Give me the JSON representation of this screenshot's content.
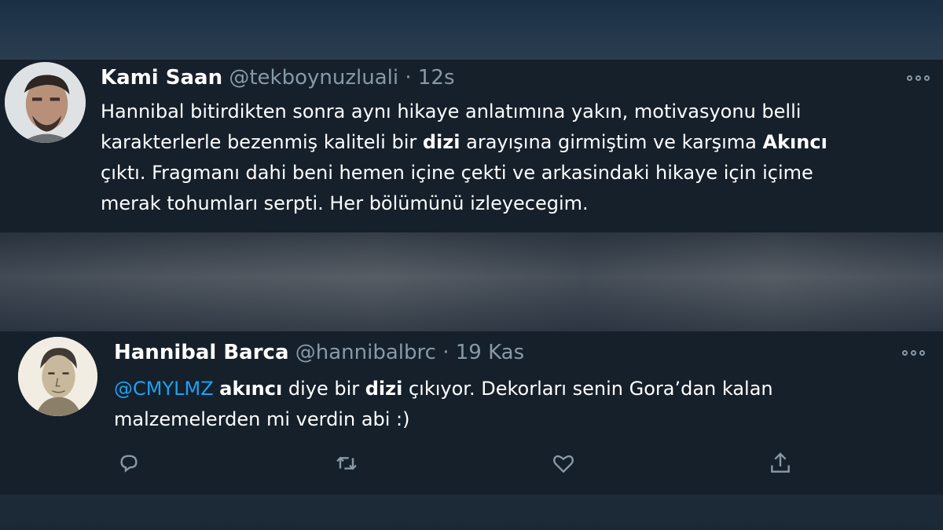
{
  "tweet1": {
    "name": "Kami Saan",
    "handle": "@tekboynuzluali",
    "separator": "·",
    "time": "12s",
    "body": {
      "line1": "Hannibal bitirdikten sonra aynı hikaye anlatımına yakın, motivasyonu belli",
      "line2_pre": "karakterlerle bezenmiş kaliteli bir ",
      "line2_bold1": "dizi",
      "line2_mid": " arayışına girmiştim ve karşıma ",
      "line2_bold2": "Akıncı",
      "line3": "çıktı. Fragmanı dahi beni hemen içine çekti ve arkasindaki hikaye için içime",
      "line4": "merak tohumları serpti. Her bölümünü izleyecegim."
    }
  },
  "tweet2": {
    "name": "Hannibal Barca",
    "handle": "@hannibalbrc",
    "separator": "·",
    "time": "19 Kas",
    "body": {
      "mention": "@CMYLMZ",
      "bold1": "akıncı",
      "mid1": " diye bir ",
      "bold2": "dizi",
      "rest_line1": " çıkıyor. Dekorları senin Gora’dan kalan",
      "line2": "malzemelerden mi verdin abi :)"
    },
    "actions": [
      "reply-icon",
      "retweet-icon",
      "like-icon",
      "share-icon"
    ]
  },
  "colors": {
    "background": "#15202b",
    "text": "#ffffff",
    "secondary": "#8899a6",
    "link": "#1da1f2"
  }
}
